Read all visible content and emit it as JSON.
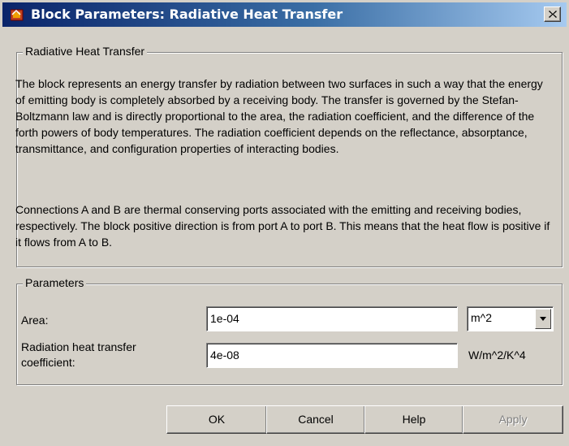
{
  "window": {
    "title": "Block Parameters: Radiative Heat Transfer"
  },
  "description": {
    "group_title": "Radiative Heat Transfer",
    "paragraph1": "The block represents an energy transfer by radiation between two surfaces in such a way that the energy of emitting body is completely absorbed by a receiving body. The transfer is governed by the Stefan-Boltzmann law and is directly proportional to the area, the radiation coefficient, and the difference of the forth powers of body temperatures. The radiation coefficient depends on the reflectance, absorptance, transmittance, and configuration properties of interacting bodies.",
    "paragraph2": "Connections A and B are thermal conserving ports associated with the emitting and receiving bodies, respectively. The block positive direction is from port A to port B. This means that the heat flow is positive if it flows from A to B."
  },
  "parameters": {
    "group_title": "Parameters",
    "area": {
      "label": "Area:",
      "value": "1e-04",
      "unit": "m^2"
    },
    "coefficient": {
      "label_line1": "Radiation heat transfer",
      "label_line2": "coefficient:",
      "value": "4e-08",
      "unit": "W/m^2/K^4"
    }
  },
  "buttons": {
    "ok": "OK",
    "cancel": "Cancel",
    "help": "Help",
    "apply": "Apply"
  },
  "icons": {
    "title_icon": "simulink-block-icon",
    "close": "close-icon",
    "dropdown": "chevron-down-icon"
  }
}
